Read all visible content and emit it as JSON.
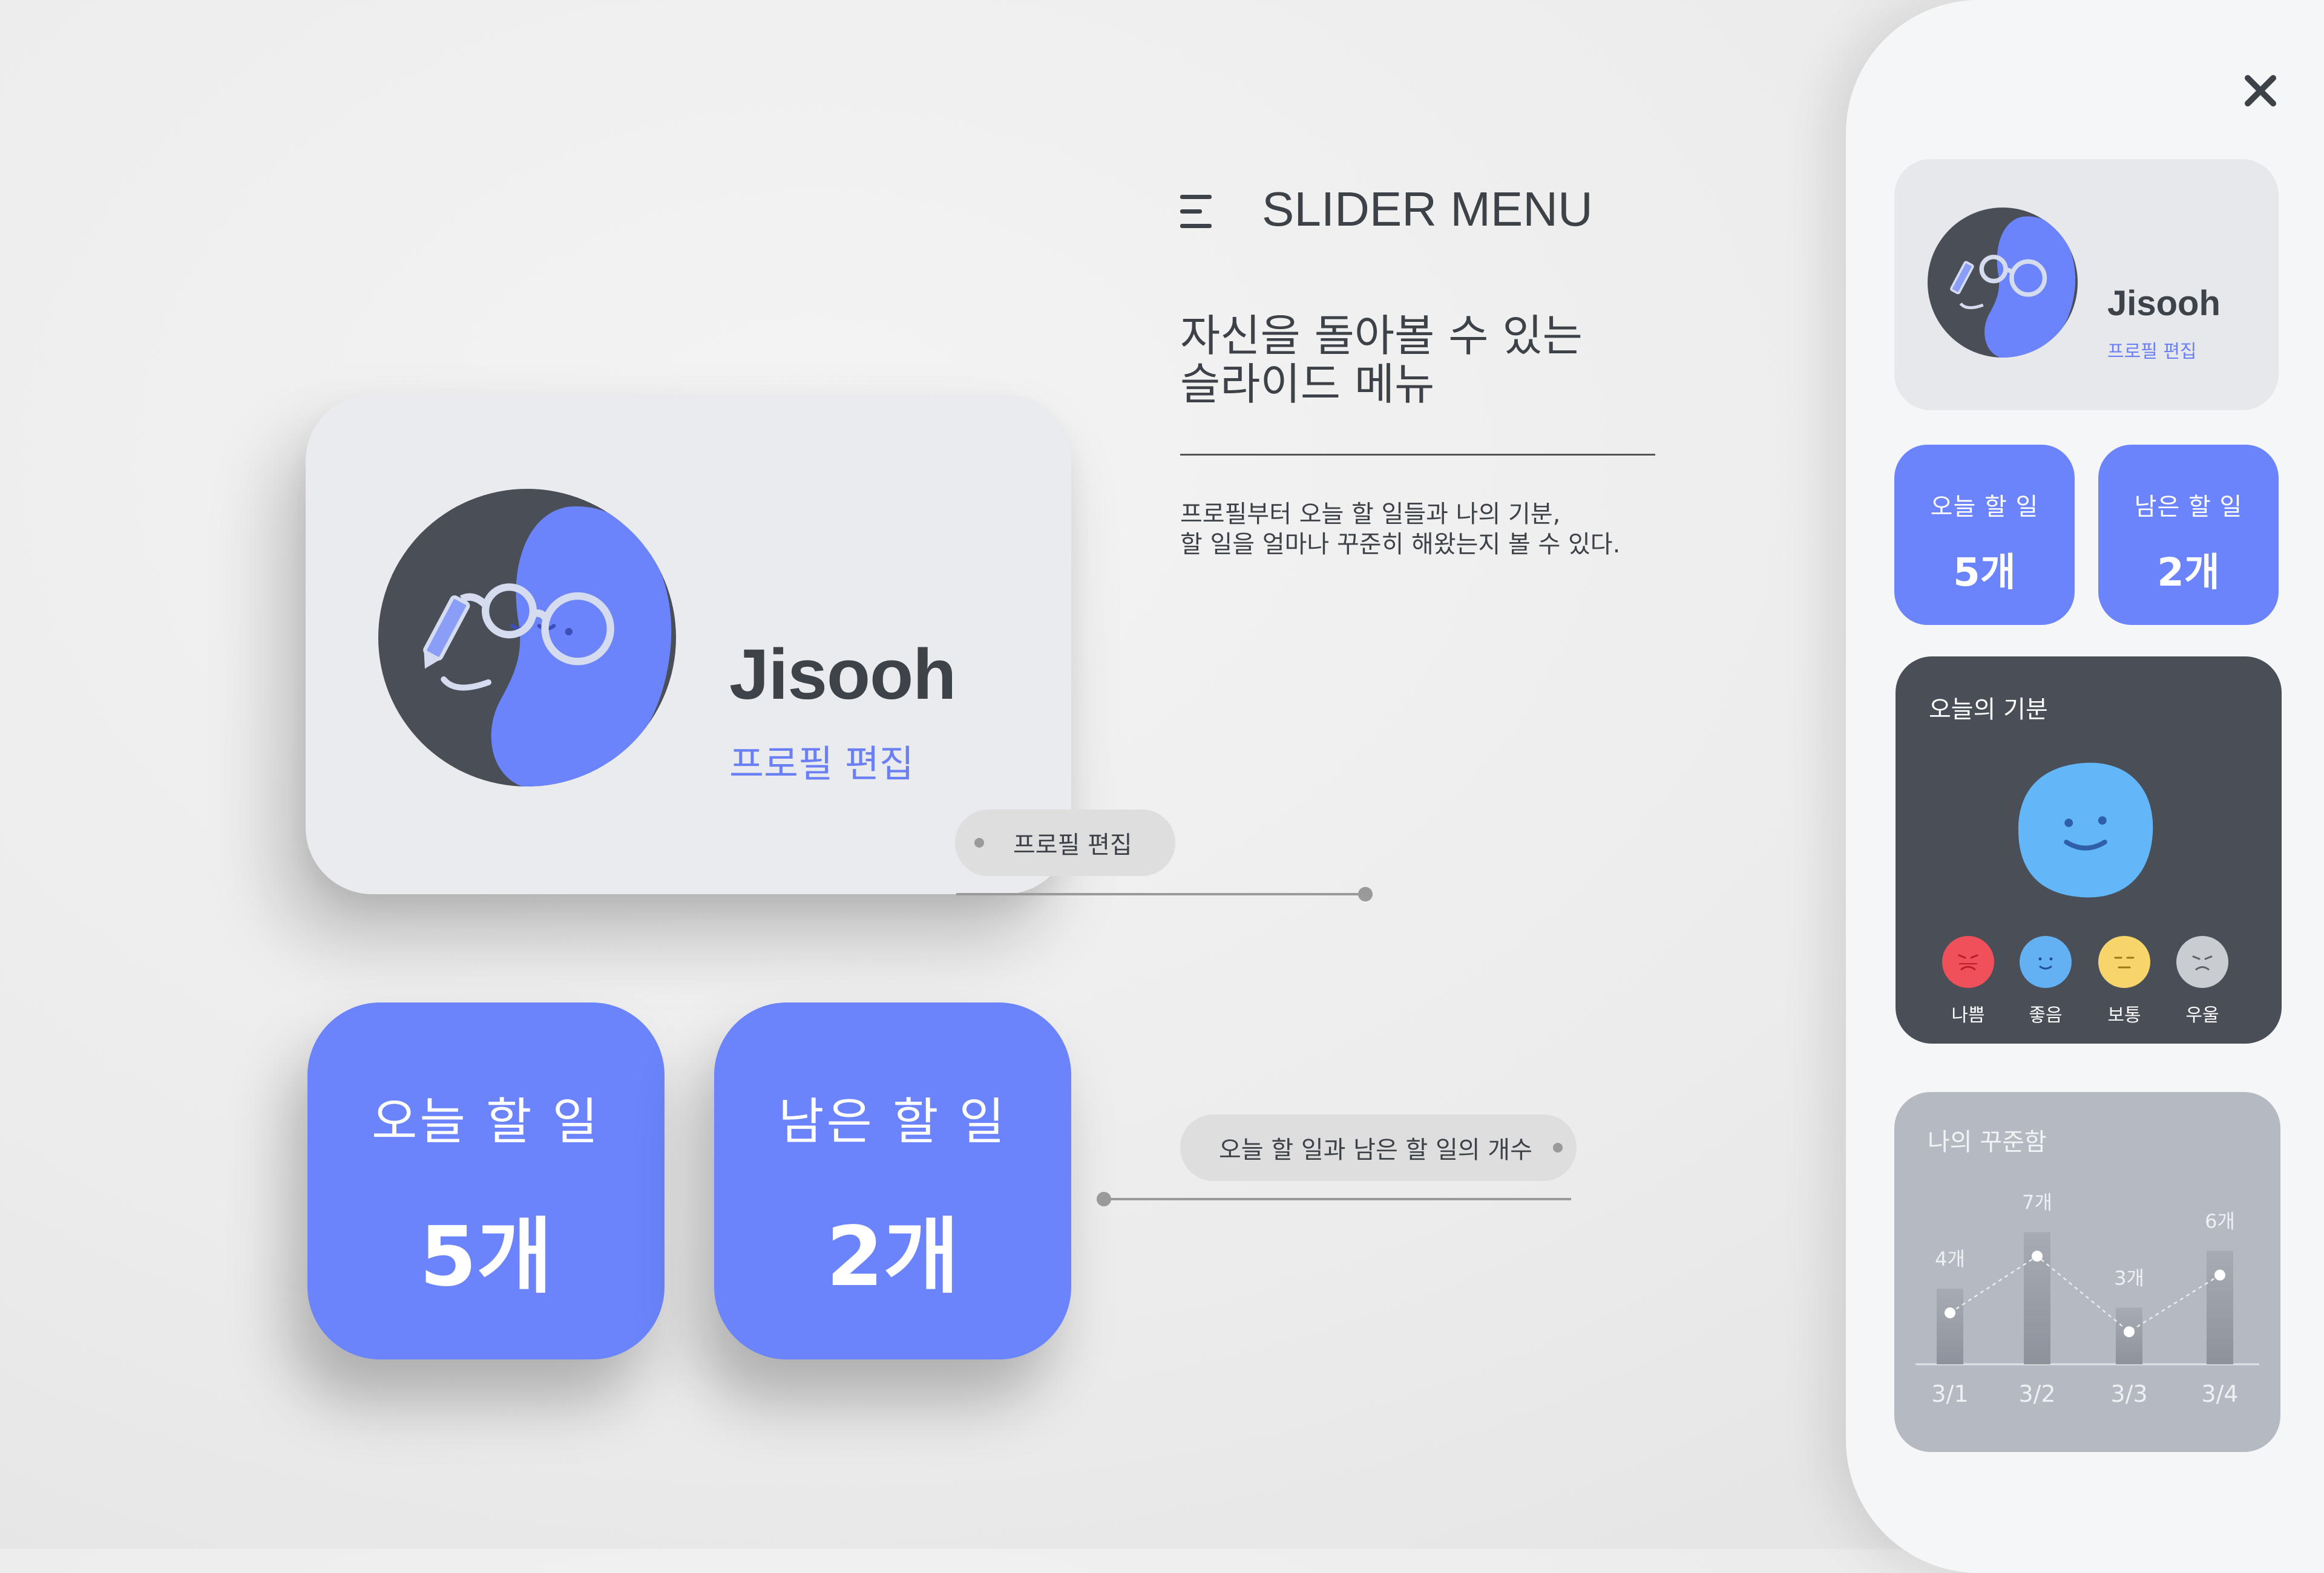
{
  "main": {
    "profile_card": {
      "name": "Jisooh",
      "edit_label": "프로필 편집"
    },
    "profile_tag": "프로필 편집",
    "stats": [
      {
        "label": "오늘 할 일",
        "value": "5개"
      },
      {
        "label": "남은 할 일",
        "value": "2개"
      }
    ],
    "stats_tag": "오늘 할 일과 남은 할 일의 개수"
  },
  "intro": {
    "title": "SLIDER MENU",
    "headline_line1": "자신을 돌아볼 수 있는",
    "headline_line2": "슬라이드 메뉴",
    "desc_line1": "프로필부터 오늘 할 일들과 나의 기분,",
    "desc_line2": "할 일을 얼마나 꾸준히 해왔는지 볼 수 있다."
  },
  "panel": {
    "close_icon": "close-icon",
    "profile": {
      "name": "Jisooh",
      "edit_label": "프로필 편집"
    },
    "stats": [
      {
        "label": "오늘 할 일",
        "value": "5개"
      },
      {
        "label": "남은 할 일",
        "value": "2개"
      }
    ],
    "mood": {
      "title": "오늘의 기분",
      "selected": "좋음",
      "options": [
        {
          "label": "나쁨",
          "color": "#f0505a"
        },
        {
          "label": "좋음",
          "color": "#63b0f3"
        },
        {
          "label": "보통",
          "color": "#f8d56b"
        },
        {
          "label": "우울",
          "color": "#c9ccd1"
        }
      ]
    },
    "steadiness": {
      "title": "나의 꾸준함"
    }
  },
  "colors": {
    "accent": "#6b84fb",
    "dark_card": "#4a4e56",
    "mood_selected": "#63b6f7"
  },
  "chart_data": {
    "type": "bar",
    "title": "나의 꾸준함",
    "categories": [
      "3/1",
      "3/2",
      "3/3",
      "3/4"
    ],
    "values": [
      4,
      7,
      3,
      6
    ],
    "value_labels": [
      "4개",
      "7개",
      "3개",
      "6개"
    ],
    "overlay": "dotted-line",
    "ylim": [
      0,
      8
    ]
  }
}
